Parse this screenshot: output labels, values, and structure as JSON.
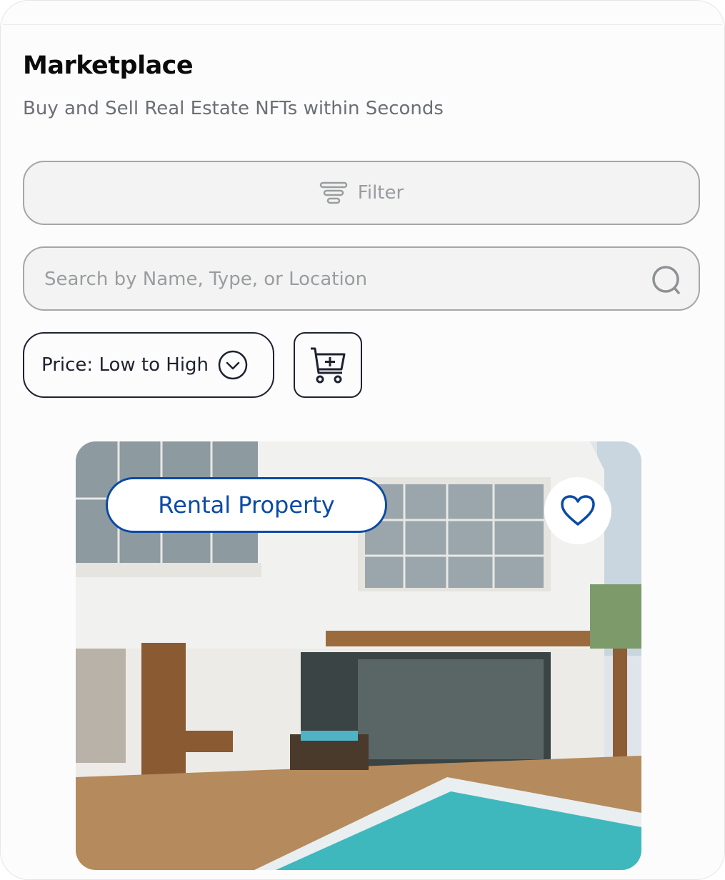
{
  "header": {
    "title": "Marketplace",
    "subtitle": "Buy and Sell Real Estate NFTs within Seconds"
  },
  "filter": {
    "label": "Filter",
    "icon": "filter-icon"
  },
  "search": {
    "placeholder": "Search by Name, Type, or Location",
    "value": "",
    "icon": "search-icon"
  },
  "sort": {
    "selected": "Price: Low to High",
    "icon": "chevron-down-circle-icon"
  },
  "cart": {
    "icon": "cart-plus-icon"
  },
  "listing": {
    "category": "Rental Property",
    "favorite_icon": "heart-icon",
    "colors": {
      "accent": "#0a4aa6"
    }
  }
}
